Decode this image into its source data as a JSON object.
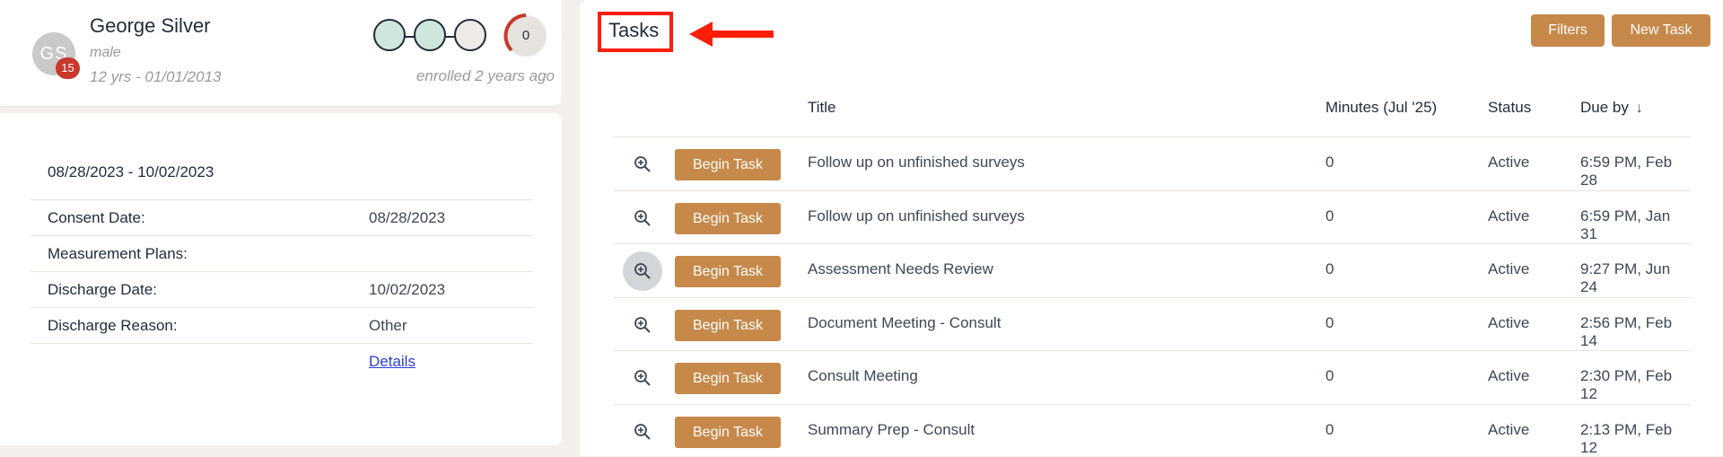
{
  "patient": {
    "initials": "GS",
    "badge_count": "15",
    "name": "George Silver",
    "gender": "male",
    "age_dob": "12 yrs - 01/01/2013",
    "enrolled": "enrolled 2 years ago",
    "score": "0"
  },
  "episode": {
    "date_range": "08/28/2023 - 10/02/2023",
    "rows": [
      {
        "label": "Consent Date:",
        "value": "08/28/2023"
      },
      {
        "label": "Measurement Plans:",
        "value": ""
      },
      {
        "label": "Discharge Date:",
        "value": "10/02/2023"
      },
      {
        "label": "Discharge Reason:",
        "value": "Other"
      }
    ],
    "details_link": "Details"
  },
  "tasks": {
    "title": "Tasks",
    "filters_label": "Filters",
    "new_task_label": "New Task",
    "columns": {
      "title": "Title",
      "minutes": "Minutes (Jul '25)",
      "status": "Status",
      "due": "Due by"
    },
    "begin_label": "Begin Task",
    "rows": [
      {
        "title": "Follow up on unfinished surveys",
        "minutes": "0",
        "status": "Active",
        "due": "6:59 PM, Feb 28"
      },
      {
        "title": "Follow up on unfinished surveys",
        "minutes": "0",
        "status": "Active",
        "due": "6:59 PM, Jan 31"
      },
      {
        "title": "Assessment Needs Review",
        "minutes": "0",
        "status": "Active",
        "due": "9:27 PM, Jun 24"
      },
      {
        "title": "Document Meeting - Consult",
        "minutes": "0",
        "status": "Active",
        "due": "2:56 PM, Feb 14"
      },
      {
        "title": "Consult Meeting",
        "minutes": "0",
        "status": "Active",
        "due": "2:30 PM, Feb 12"
      },
      {
        "title": "Summary Prep - Consult",
        "minutes": "0",
        "status": "Active",
        "due": "2:13 PM, Feb 12"
      }
    ]
  },
  "colors": {
    "accent_button": "#c6894a",
    "annotation_red": "#ff1e0a",
    "badge_red": "#c8382b",
    "stage_filled": "#cfe6dc",
    "stage_empty": "#eeeae6"
  },
  "icons": [
    "zoom-in-icon",
    "sort-down-arrow-icon",
    "annotation-arrow-icon"
  ]
}
